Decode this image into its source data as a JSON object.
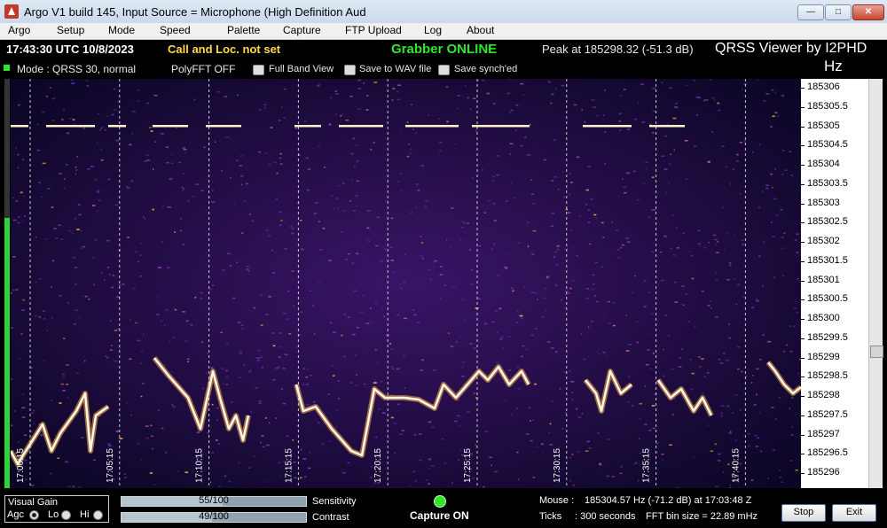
{
  "window": {
    "title": "Argo V1 build 145, Input Source = Microphone (High Definition Aud",
    "minimize_glyph": "—",
    "maximize_glyph": "□",
    "close_glyph": "✕"
  },
  "menu": [
    "Argo",
    "Setup",
    "Mode",
    "Speed",
    "Palette",
    "Capture",
    "FTP Upload",
    "Log",
    "About"
  ],
  "info": {
    "time": "17:43:30 UTC  10/8/2023",
    "call": "Call and Loc. not set",
    "grabber": "Grabber ONLINE",
    "peak": "Peak at  185298.32 (-51.3 dB)",
    "viewer": "QRSS Viewer by I2PHD",
    "hz_unit": "Hz",
    "mode": "Mode : QRSS 30, normal",
    "polyfft": "PolyFFT OFF",
    "checkboxes": [
      "Full Band View",
      "Save to WAV file",
      "Save synch'ed"
    ]
  },
  "waterfall": {
    "time_markers": [
      "17:00:15",
      "17:05:15",
      "17:10:15",
      "17:15:15",
      "17:20:15",
      "17:25:15",
      "17:30:15",
      "17:35:15",
      "17:40:15"
    ],
    "agc_level_fraction": 0.66
  },
  "scale": [
    "185306",
    "185305.5",
    "185305",
    "185304.5",
    "185304",
    "185303.5",
    "185303",
    "185302.5",
    "185302",
    "185301.5",
    "185301",
    "185300.5",
    "185300",
    "185299.5",
    "185299",
    "185298.5",
    "185298",
    "185297.5",
    "185297",
    "185296.5",
    "185296"
  ],
  "bottom": {
    "visual_gain_title": "Visual Gain",
    "radio": [
      "Agc",
      "Lo",
      "Hi"
    ],
    "radio_selected": "Agc",
    "sensitivity_value": "55/100",
    "sensitivity_fraction": 0.55,
    "sensitivity_label": "Sensitivity",
    "contrast_value": "49/100",
    "contrast_fraction": 0.49,
    "contrast_label": "Contrast",
    "capture": "Capture ON",
    "mouse_label": "Mouse :",
    "mouse_value": "185304.57 Hz  (-71.2 dB) at 17:03:48 Z",
    "ticks_label": "Ticks",
    "ticks_value": ": 300 seconds",
    "fft_bin": "FFT bin size = 22.89 mHz",
    "stop": "Stop",
    "exit": "Exit"
  }
}
